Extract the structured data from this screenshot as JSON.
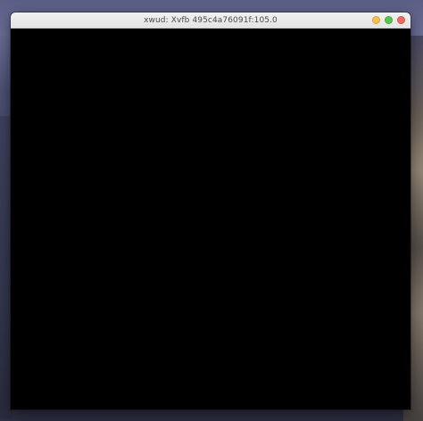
{
  "window": {
    "title": "xwud: Xvfb 495c4a76091f:105.0"
  },
  "controls": [
    {
      "name": "minimize",
      "color": "#f5bf4f"
    },
    {
      "name": "maximize",
      "color": "#59c650"
    },
    {
      "name": "close",
      "color": "#ee6a5e"
    }
  ],
  "content": {
    "background": "#000000"
  }
}
